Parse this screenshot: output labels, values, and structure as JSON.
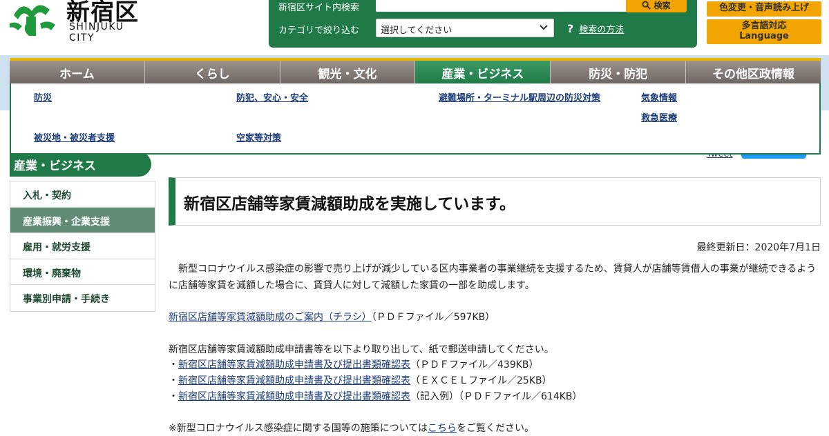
{
  "header": {
    "logo_name": "新宿区",
    "logo_sub": "SHINJUKU CITY",
    "search_label": "新宿区サイト内検索",
    "search_button": "検索",
    "category_label": "カテゴリで絞り込む",
    "category_selected": "選択してください",
    "help_link": "検索の方法",
    "util_color": "色変更・音声読み上げ",
    "util_lang_1": "多言語対応",
    "util_lang_2": "Language",
    "colors": {
      "green": "#1f7a47",
      "orange": "#f2a400",
      "band": "#cfe1f0"
    }
  },
  "gnav": {
    "items": [
      "ホーム",
      "くらし",
      "観光・文化",
      "産業・ビジネス",
      "防災・防犯",
      "その他区政情報"
    ]
  },
  "dropdown": {
    "links": [
      "防災",
      "防犯、安心・安全",
      "避難場所・ターミナル駅周辺の防災対策",
      "気象情報",
      "救急医療",
      "被災地・被災者支援",
      "空家等対策"
    ]
  },
  "sidebar": {
    "heading": "産業・ビジネス",
    "items": [
      "入札・契約",
      "産業振興・企業支援",
      "雇用・就労支援",
      "環境・廃棄物",
      "事業別申請・手続き"
    ]
  },
  "main": {
    "tweet": "Tweet",
    "title": "新宿区店舗等家賃減額助成を実施しています。",
    "updated": "最終更新日：2020年7月1日",
    "intro": "新型コロナウイルス感染症の影響で売り上げが減少している区内事業者の事業継続を支援するため、賃貸人が店舗等賃借人の事業が継続できるように店舗等家賃を減額した場合に、賃貸人に対して減額した家賃の一部を助成します。",
    "flyer_link": "新宿区店舗等家賃減額助成のご案内（チラシ）",
    "flyer_meta": "（ＰＤＦファイル／597KB）",
    "apply_text": "新宿区店舗等家賃減額助成申請書等を以下より取り出して、紙で郵送申請してください。",
    "forms": [
      {
        "link": "新宿区店舗等家賃減額助成申請書及び提出書類確認表",
        "meta": "（ＰＤＦファイル／439KB）"
      },
      {
        "link": "新宿区店舗等家賃減額助成申請書及び提出書類確認表",
        "meta": "（ＥＸＣＥＬファイル／25KB）"
      },
      {
        "link": "新宿区店舗等家賃減額助成申請書及び提出書類確認表",
        "meta": "（記入例）（ＰＤＦファイル／614KB）"
      }
    ],
    "note_pre": "※新型コロナウイルス感染症に関する国等の施策については",
    "note_link": "こちら",
    "note_post": "をご覧ください。"
  }
}
